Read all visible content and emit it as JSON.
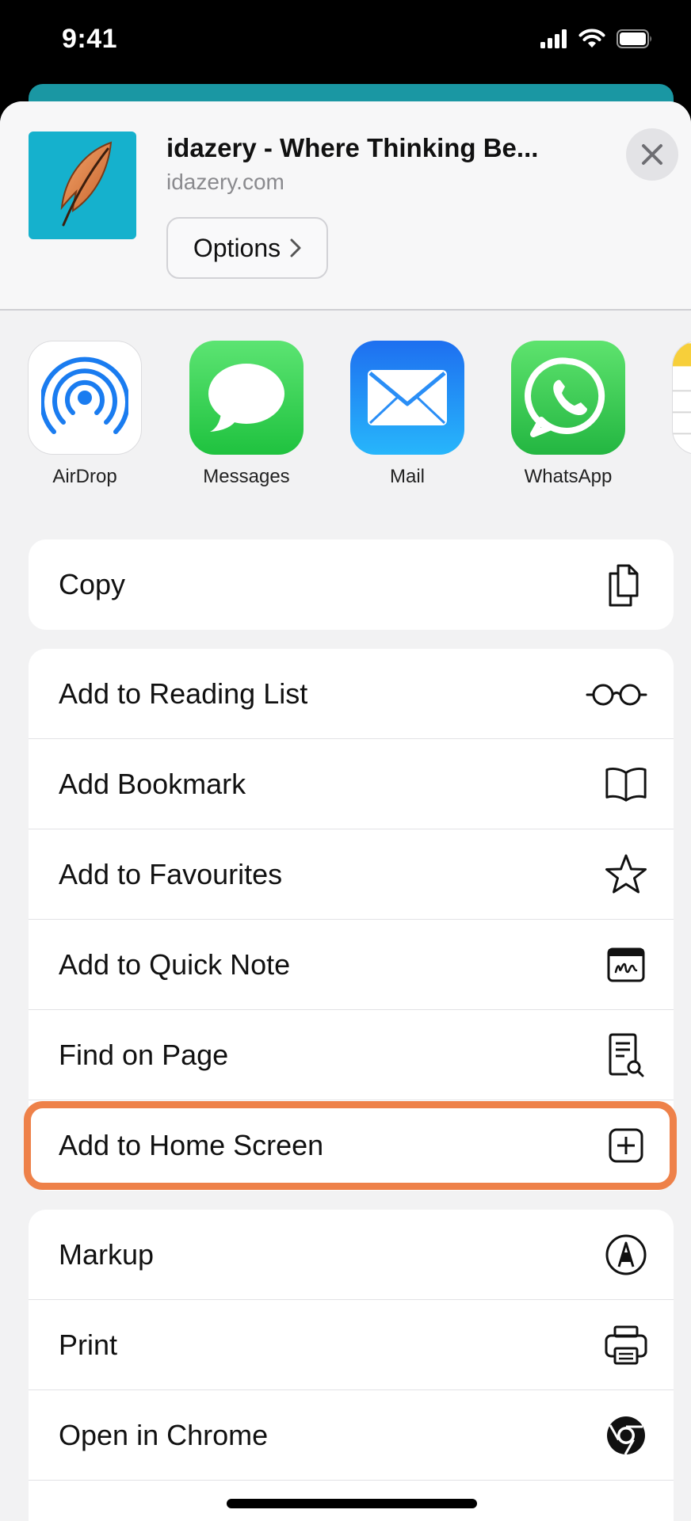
{
  "status": {
    "time": "9:41"
  },
  "header": {
    "title": "idazery - Where Thinking Be...",
    "url": "idazery.com",
    "options_label": "Options"
  },
  "apps": [
    {
      "label": "AirDrop",
      "icon": "airdrop-icon"
    },
    {
      "label": "Messages",
      "icon": "messages-icon"
    },
    {
      "label": "Mail",
      "icon": "mail-icon"
    },
    {
      "label": "WhatsApp",
      "icon": "whatsapp-icon"
    }
  ],
  "actions": {
    "copy": "Copy",
    "reading_list": "Add to Reading List",
    "bookmark": "Add Bookmark",
    "favourites": "Add to Favourites",
    "quick_note": "Add to Quick Note",
    "find": "Find on Page",
    "home_screen": "Add to Home Screen",
    "markup": "Markup",
    "print": "Print",
    "chrome": "Open in Chrome"
  },
  "colors": {
    "highlight": "#ee8149",
    "thumb_bg": "#15b1cd",
    "messages_green": "#2fd158",
    "mail_blue": "#1a8cf7",
    "whatsapp_green": "#2dc24f"
  }
}
